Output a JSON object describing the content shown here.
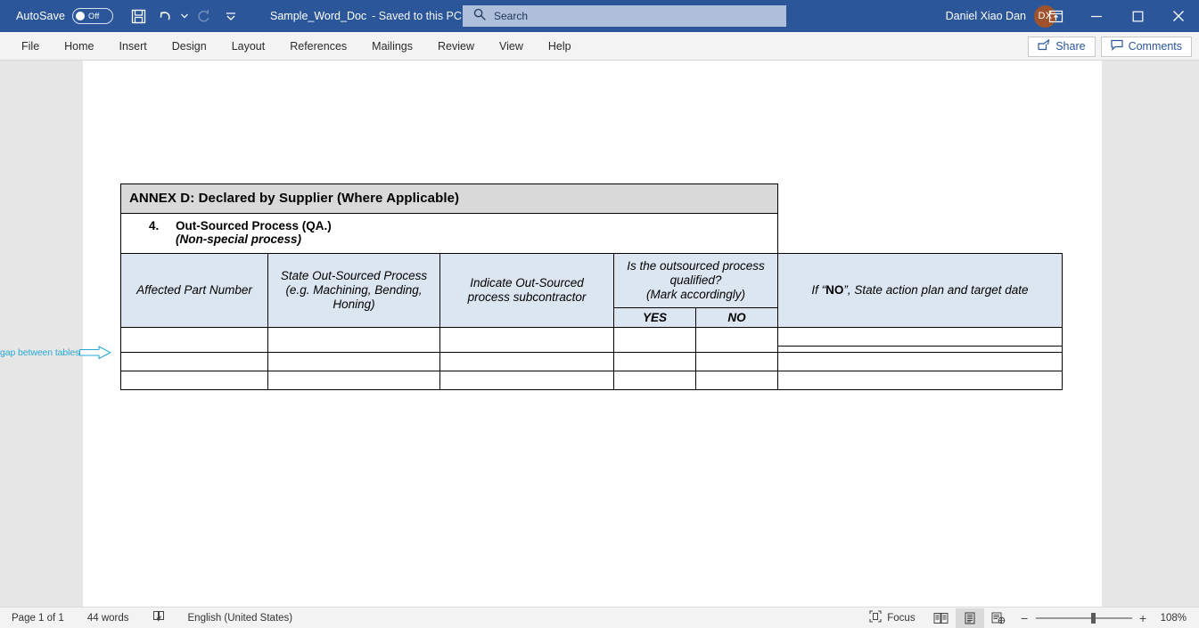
{
  "titlebar": {
    "autosave_label": "AutoSave",
    "autosave_state": "Off",
    "save_icon": "save-icon",
    "undo_icon": "undo-icon",
    "redo_icon": "redo-icon",
    "customize_icon": "customize-quick-access-icon",
    "document_name": "Sample_Word_Doc",
    "save_status": "- Saved to this PC",
    "user_name": "Daniel Xiao Dan",
    "user_initials": "DX",
    "ribbon_display_icon": "ribbon-display-options-icon",
    "minimize_icon": "minimize-icon",
    "maximize_icon": "maximize-icon",
    "close_icon": "close-icon"
  },
  "search": {
    "placeholder": "Search",
    "icon": "search-icon"
  },
  "ribbon": {
    "tabs": [
      {
        "label": "File"
      },
      {
        "label": "Home"
      },
      {
        "label": "Insert"
      },
      {
        "label": "Design"
      },
      {
        "label": "Layout"
      },
      {
        "label": "References"
      },
      {
        "label": "Mailings"
      },
      {
        "label": "Review"
      },
      {
        "label": "View"
      },
      {
        "label": "Help"
      }
    ],
    "share_label": "Share",
    "comments_label": "Comments"
  },
  "document": {
    "annex_title": "ANNEX D: Declared by Supplier (Where Applicable)",
    "section_number": "4.",
    "section_title": "Out-Sourced Process (QA.)",
    "section_subtitle": "(Non-special process)",
    "columns": [
      "Affected Part Number",
      "State Out-Sourced Process (e.g. Machining, Bending, Honing)",
      "Indicate Out-Sourced process subcontractor",
      "Is the outsourced process qualified? (Mark accordingly)",
      "If “NO”, State action plan and target date"
    ],
    "col2_line1": "State Out-Sourced Process",
    "col2_line2": "(e.g. Machining, Bending,",
    "col2_line3": "Honing)",
    "col3_line1": "Indicate Out-Sourced",
    "col3_line2": "process subcontractor",
    "col4_line1": "Is the outsourced process",
    "col4_line2": "qualified?",
    "col4_line3": "(Mark accordingly)",
    "col4_yes": "YES",
    "col4_no": "NO",
    "col5_pre": "If “",
    "col5_bold": "NO",
    "col5_post": "”, State action plan and target date"
  },
  "annotation": {
    "label": "gap between tables",
    "color": "#29a8d8"
  },
  "statusbar": {
    "page_indicator": "Page 1 of 1",
    "word_count": "44 words",
    "proofing_icon": "proofing-errors-icon",
    "language": "English (United States)",
    "focus_label": "Focus",
    "focus_icon": "focus-mode-icon",
    "read_mode_icon": "read-mode-icon",
    "print_layout_icon": "print-layout-icon",
    "web_layout_icon": "web-layout-icon",
    "zoom_out_icon": "zoom-out-icon",
    "zoom_in_icon": "zoom-in-icon",
    "zoom_level": "108%"
  }
}
